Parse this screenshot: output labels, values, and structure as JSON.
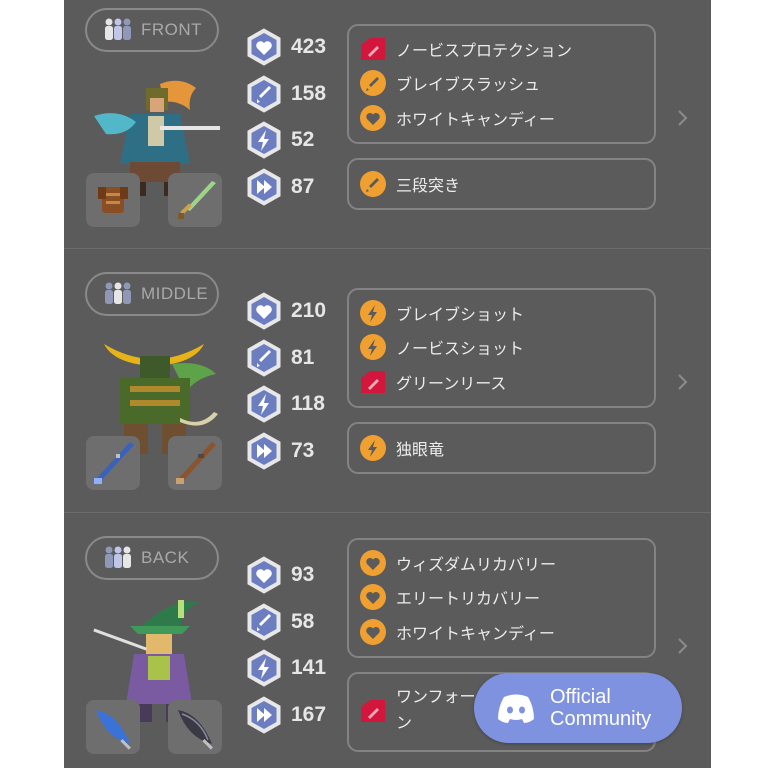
{
  "party": [
    {
      "position": "FRONT",
      "character_icon": "swordsman-sprite",
      "weapons": [
        "leather-armor-icon",
        "green-sword-icon"
      ],
      "stats": [
        {
          "type": "hp",
          "icon": "heart-icon",
          "value": "423"
        },
        {
          "type": "attack",
          "icon": "sword-icon",
          "value": "158"
        },
        {
          "type": "magic",
          "icon": "lightning-icon",
          "value": "52"
        },
        {
          "type": "speed",
          "icon": "fast-forward-icon",
          "value": "87"
        }
      ],
      "skills": [
        {
          "label": "ノービスプロテクション",
          "icon": "shield-red-icon"
        },
        {
          "label": "ブレイブスラッシュ",
          "icon": "sword-orange-icon"
        },
        {
          "label": "ホワイトキャンディー",
          "icon": "heart-orange-icon"
        }
      ],
      "special": {
        "label": "三段突き",
        "icon": "sword-orange-icon"
      }
    },
    {
      "position": "MIDDLE",
      "character_icon": "samurai-sprite",
      "weapons": [
        "blue-rifle-icon",
        "brown-rifle-icon"
      ],
      "stats": [
        {
          "type": "hp",
          "icon": "heart-icon",
          "value": "210"
        },
        {
          "type": "attack",
          "icon": "sword-icon",
          "value": "81"
        },
        {
          "type": "magic",
          "icon": "lightning-icon",
          "value": "118"
        },
        {
          "type": "speed",
          "icon": "fast-forward-icon",
          "value": "73"
        }
      ],
      "skills": [
        {
          "label": "ブレイブショット",
          "icon": "lightning-orange-icon"
        },
        {
          "label": "ノービスショット",
          "icon": "lightning-orange-icon"
        },
        {
          "label": "グリーンリース",
          "icon": "shield-red-icon"
        }
      ],
      "special": {
        "label": "独眼竜",
        "icon": "lightning-orange-icon"
      }
    },
    {
      "position": "BACK",
      "character_icon": "mage-sprite",
      "weapons": [
        "blue-quill-icon",
        "grey-quill-icon"
      ],
      "stats": [
        {
          "type": "hp",
          "icon": "heart-icon",
          "value": "93"
        },
        {
          "type": "attack",
          "icon": "sword-icon",
          "value": "58"
        },
        {
          "type": "magic",
          "icon": "lightning-icon",
          "value": "141"
        },
        {
          "type": "speed",
          "icon": "fast-forward-icon",
          "value": "167"
        }
      ],
      "skills": [
        {
          "label": "ウィズダムリカバリー",
          "icon": "heart-orange-icon"
        },
        {
          "label": "エリートリカバリー",
          "icon": "heart-orange-icon"
        },
        {
          "label": "ホワイトキャンディー",
          "icon": "heart-orange-icon"
        }
      ],
      "special": {
        "label_line1": "ワンフォー",
        "label_line2": "ン",
        "icon": "shield-red-icon"
      }
    }
  ],
  "community_button": {
    "line1": "Official",
    "line2": "Community",
    "icon": "discord-icon"
  },
  "colors": {
    "panel": "#5b5b5b",
    "accent_orange": "#f0a030",
    "accent_red": "#d3173c",
    "discord_blue": "#7e92e0"
  }
}
